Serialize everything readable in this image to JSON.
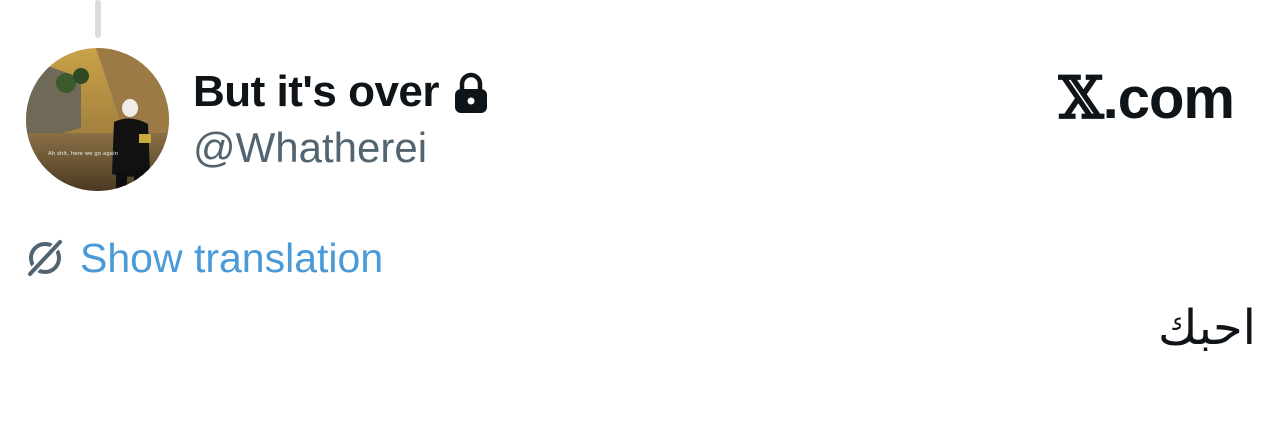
{
  "tweet": {
    "author": {
      "display_name": "But it's over",
      "handle": "@Whatherei",
      "protected_icon": "lock-icon",
      "avatar_caption": "Ah shit, here we go again"
    },
    "brand": {
      "x_glyph": "𝕏",
      "suffix": ".com"
    },
    "translate": {
      "label": "Show translation",
      "icon": "globe-slash-icon"
    },
    "text": "احبك"
  },
  "colors": {
    "primary_text": "#0f1419",
    "secondary_text": "#536471",
    "link": "#4a9ad8",
    "thread_line": "#d7dce0"
  }
}
